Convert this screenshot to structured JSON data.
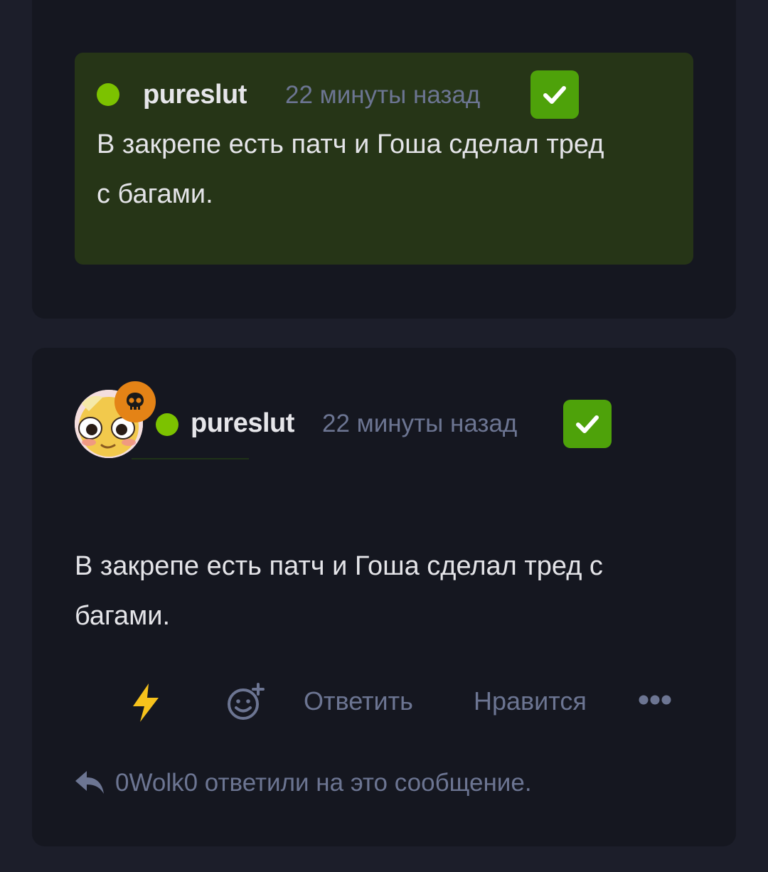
{
  "quote_post": {
    "username": "pureslut",
    "timestamp": "22 минуты назад",
    "text_line1": "В закрепе есть патч и Гоша сделал тред",
    "text_line2": "с багами."
  },
  "post": {
    "username": "pureslut",
    "timestamp": "22 минуты назад",
    "text_line1": "В закрепе есть патч и Гоша сделал тред с",
    "text_line2": "багами.",
    "actions": {
      "reply_label": "Ответить",
      "like_label": "Нравится"
    },
    "reply_note": "0Wolk0 ответили на это сообщение."
  },
  "icons": {
    "check": "check-icon",
    "skull": "skull-icon",
    "lightning": "lightning-icon",
    "add_reaction": "add-reaction-icon",
    "more": "more-icon",
    "reply_arrow": "reply-arrow-icon"
  },
  "colors": {
    "online": "#7cc200",
    "verified": "#4ea20a",
    "quote_bg": "#263517",
    "skull_badge": "#e48316",
    "lightning": "#f6c21c"
  }
}
